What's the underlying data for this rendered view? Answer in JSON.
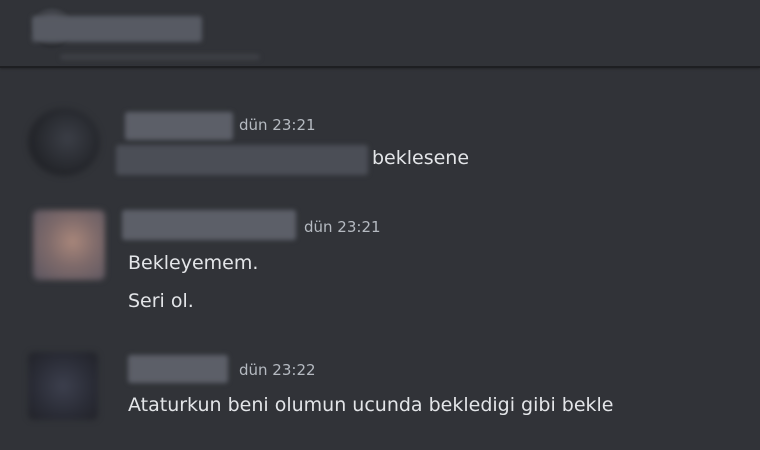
{
  "header": {
    "channel_name_redacted": true
  },
  "messages": [
    {
      "timestamp": "dün 23:21",
      "text": "beklesene"
    },
    {
      "timestamp": "dün 23:21",
      "lines": [
        "Bekleyemem.",
        "Seri ol."
      ]
    },
    {
      "timestamp": "dün 23:22",
      "text": "Ataturkun beni olumun ucunda bekledigi gibi bekle"
    }
  ]
}
